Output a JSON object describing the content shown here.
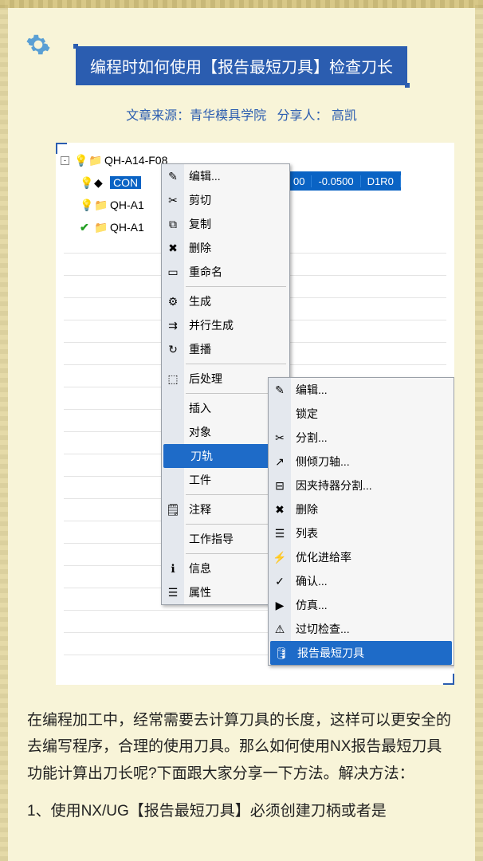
{
  "title": "编程时如何使用【报告最短刀具】检查刀长",
  "source": {
    "label": "文章来源：",
    "org": "青华模具学院",
    "sharer_label": "分享人：",
    "sharer": "高凯"
  },
  "tree": {
    "root": "QH-A14-F08",
    "row1": "CON",
    "row2": "QH-A1",
    "row3": "QH-A1",
    "gridvals": [
      "00",
      "-0.0500",
      "D1R0"
    ]
  },
  "menu1": {
    "items": [
      {
        "label": "编辑...",
        "icon": "edit"
      },
      {
        "label": "剪切",
        "icon": "cut"
      },
      {
        "label": "复制",
        "icon": "copy"
      },
      {
        "label": "删除",
        "icon": "delete"
      },
      {
        "label": "重命名",
        "icon": "rename"
      }
    ],
    "items2": [
      {
        "label": "生成",
        "icon": "generate"
      },
      {
        "label": "并行生成",
        "icon": "parallel"
      },
      {
        "label": "重播",
        "icon": "replay"
      }
    ],
    "items3": [
      {
        "label": "后处理",
        "icon": "postprocess"
      }
    ],
    "items4": [
      {
        "label": "插入",
        "sub": true
      },
      {
        "label": "对象",
        "sub": true
      },
      {
        "label": "刀轨",
        "sub": true,
        "hover": true
      },
      {
        "label": "工件",
        "sub": true
      }
    ],
    "items5": [
      {
        "label": "注释",
        "icon": "note"
      }
    ],
    "items6": [
      {
        "label": "工作指导",
        "sub": true
      }
    ],
    "items7": [
      {
        "label": "信息",
        "icon": "info"
      },
      {
        "label": "属性",
        "icon": "props"
      }
    ]
  },
  "menu2": {
    "items": [
      {
        "label": "编辑...",
        "icon": "edit"
      },
      {
        "label": "锁定"
      },
      {
        "label": "分割...",
        "icon": "split"
      },
      {
        "label": "侧倾刀轴...",
        "icon": "tilt"
      },
      {
        "label": "因夹持器分割...",
        "icon": "holder"
      },
      {
        "label": "删除",
        "icon": "delete"
      },
      {
        "label": "列表",
        "icon": "list"
      },
      {
        "label": "优化进给率",
        "icon": "optimize"
      },
      {
        "label": "确认...",
        "icon": "confirm"
      },
      {
        "label": "仿真...",
        "icon": "simulate"
      },
      {
        "label": "过切检查...",
        "icon": "gouge"
      },
      {
        "label": "报告最短刀具",
        "icon": "report",
        "hover": true
      }
    ]
  },
  "article": {
    "p1": "在编程加工中，经常需要去计算刀具的长度，这样可以更安全的去编写程序，合理的使用刀具。那么如何使用NX报告最短刀具功能计算出刀长呢?下面跟大家分享一下方法。解决方法：",
    "p2": "1、使用NX/UG【报告最短刀具】必须创建刀柄或者是"
  }
}
